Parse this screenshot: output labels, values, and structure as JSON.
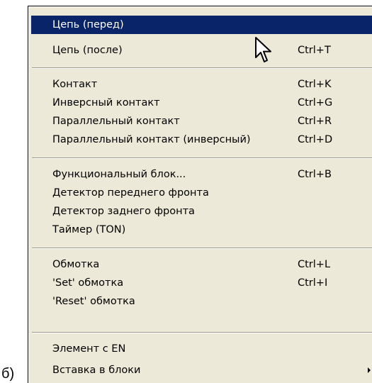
{
  "caption": "б)",
  "menu": {
    "items": [
      {
        "label": "Цепь (перед)",
        "shortcut": ""
      },
      {
        "label": "Цепь (после)",
        "shortcut": "Ctrl+T"
      },
      {
        "label": "Контакт",
        "shortcut": "Ctrl+K"
      },
      {
        "label": "Инверсный контакт",
        "shortcut": "Ctrl+G"
      },
      {
        "label": "Параллельный контакт",
        "shortcut": "Ctrl+R"
      },
      {
        "label": "Параллельный контакт (инверсный)",
        "shortcut": "Ctrl+D"
      },
      {
        "label": "Функциональный блок...",
        "shortcut": "Ctrl+B"
      },
      {
        "label": "Детектор переднего фронта",
        "shortcut": ""
      },
      {
        "label": "Детектор заднего фронта",
        "shortcut": ""
      },
      {
        "label": "Таймер (TON)",
        "shortcut": ""
      },
      {
        "label": "Обмотка",
        "shortcut": "Ctrl+L"
      },
      {
        "label": "'Set' обмотка",
        "shortcut": "Ctrl+I"
      },
      {
        "label": "'Reset' обмотка",
        "shortcut": ""
      },
      {
        "label": "Элемент с EN",
        "shortcut": ""
      },
      {
        "label": "Вставка в блоки",
        "shortcut": ""
      }
    ]
  },
  "icons": {
    "cursor": "arrow-cursor-icon",
    "submenu": "submenu-arrow-icon"
  },
  "colors": {
    "highlight": "#0a246a",
    "menu_bg": "#ece9d8"
  }
}
